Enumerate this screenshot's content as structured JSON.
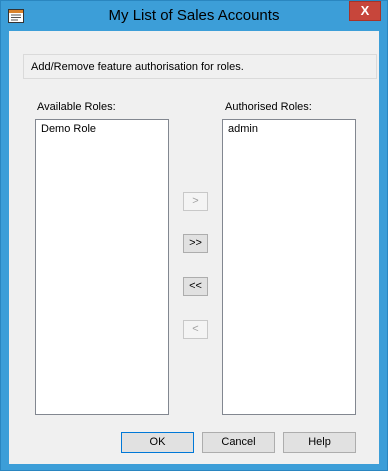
{
  "window": {
    "title": "My List of Sales Accounts",
    "close_label": "X"
  },
  "instructions": "Add/Remove feature authorisation for roles.",
  "available": {
    "label": "Available Roles:",
    "items": [
      "Demo Role"
    ]
  },
  "authorised": {
    "label": "Authorised Roles:",
    "items": [
      "admin"
    ]
  },
  "move_buttons": {
    "add": ">",
    "add_all": ">>",
    "remove_all": "<<",
    "remove": "<"
  },
  "dialog_buttons": {
    "ok": "OK",
    "cancel": "Cancel",
    "help": "Help"
  },
  "colors": {
    "title_bar": "#3c9ed8",
    "close_button": "#c7463b",
    "dialog_bg": "#f0f0f0"
  },
  "icons": {
    "app": "app-icon",
    "close": "close-icon"
  }
}
